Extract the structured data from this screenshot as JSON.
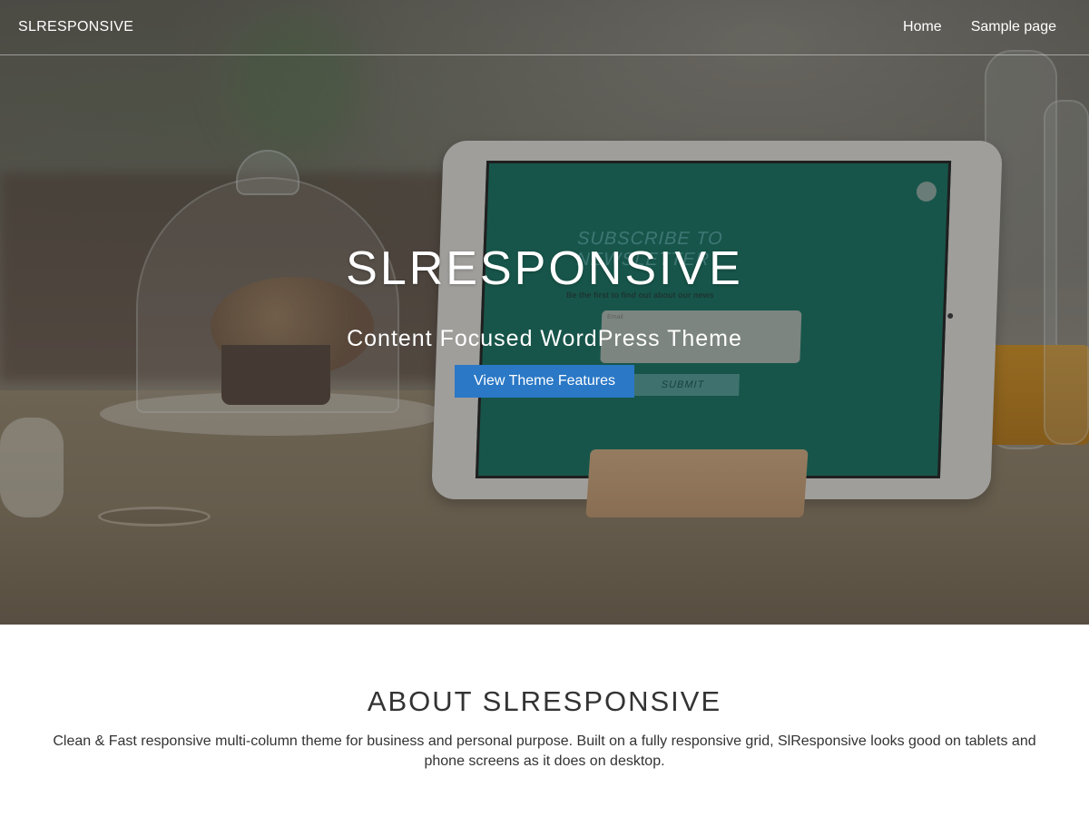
{
  "nav": {
    "brand": "SLRESPONSIVE",
    "links": [
      "Home",
      "Sample page"
    ]
  },
  "hero": {
    "title": "SLRESPONSIVE",
    "subtitle": "Content Focused WordPress Theme",
    "button_label": "View Theme Features",
    "button_color": "#2a78c6",
    "tablet_screen": {
      "heading": "SUBSCRIBE TO NEWSLETTER",
      "subheading": "Be the first to find out about our news",
      "input_label": "Email",
      "submit_label": "SUBMIT"
    }
  },
  "about": {
    "title": "ABOUT SLRESPONSIVE",
    "text": "Clean & Fast responsive multi-column theme for business and personal purpose. Built on a fully responsive grid, SlResponsive looks good on tablets and phone screens as it does on desktop."
  }
}
